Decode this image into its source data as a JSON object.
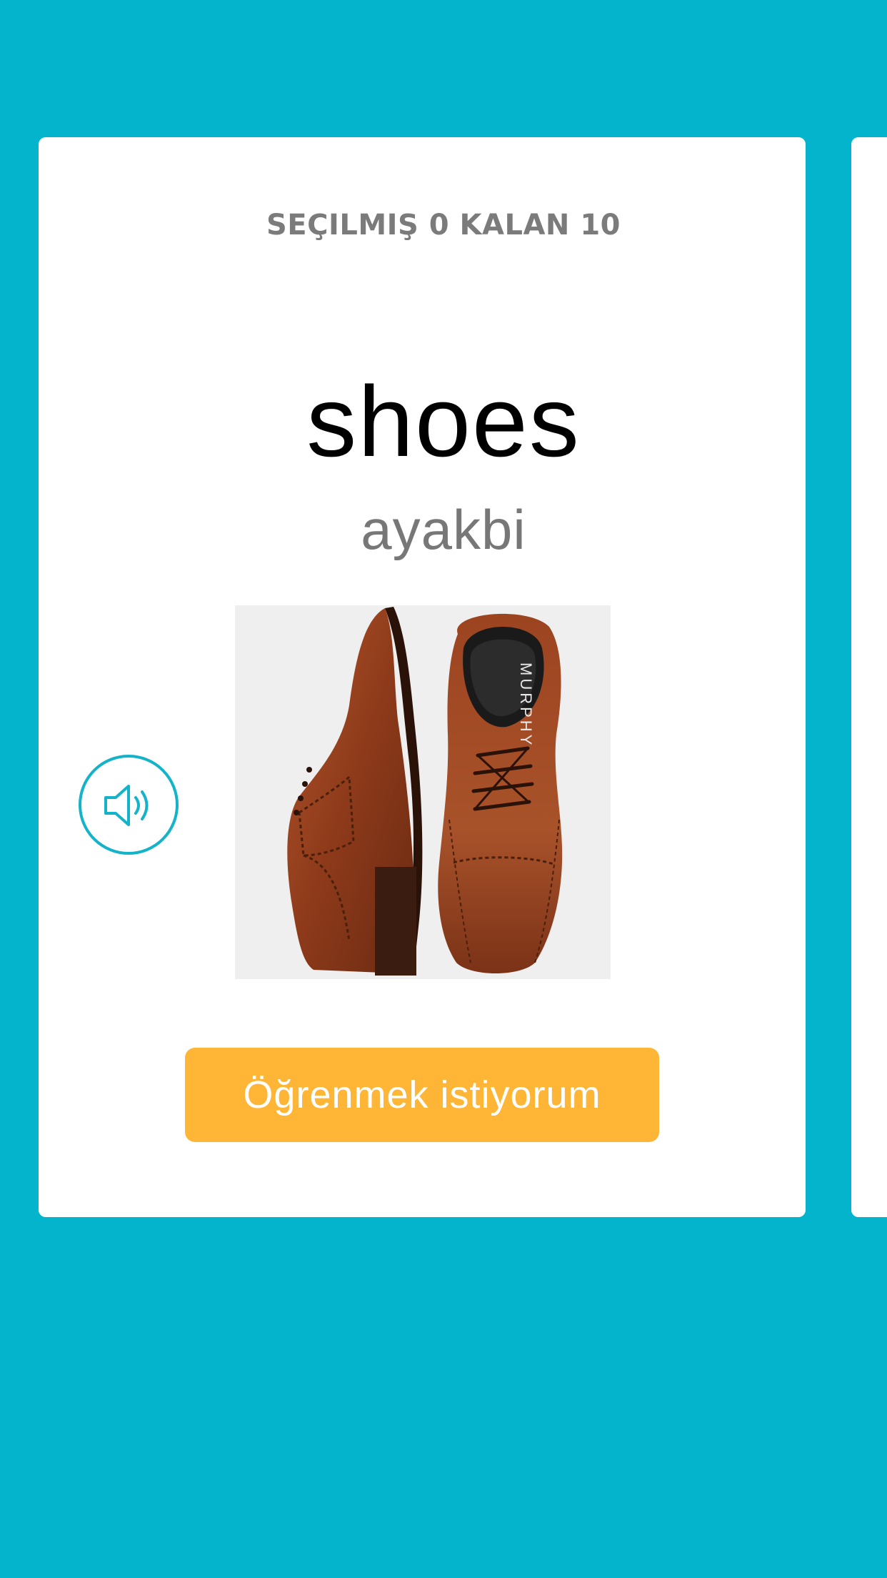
{
  "card": {
    "counter": "SEÇILMIŞ 0 KALAN 10",
    "word": "shoes",
    "transliteration": "ayakbi",
    "image_label": "MURPHY",
    "learn_button_label": "Öğrenmek istiyorum",
    "sound_icon": "speaker-volume-icon"
  },
  "colors": {
    "background": "#03b4cc",
    "card": "#ffffff",
    "button": "#ffb636",
    "icon": "#14b3ca"
  }
}
